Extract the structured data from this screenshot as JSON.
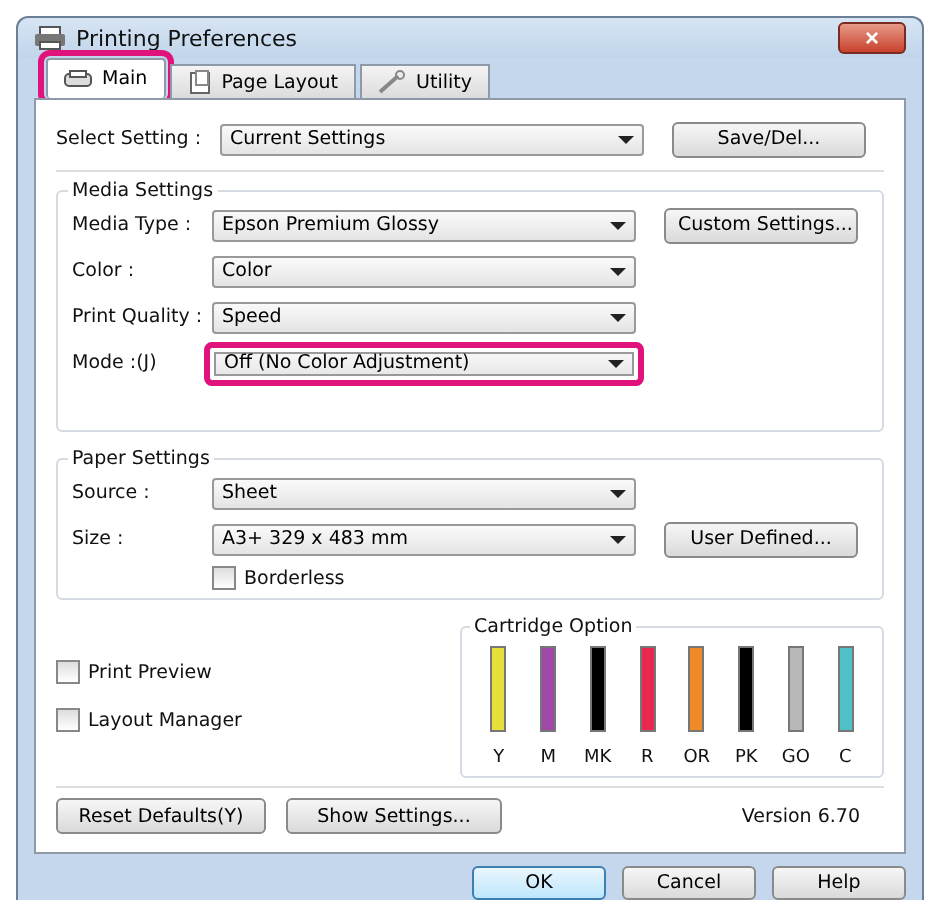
{
  "window": {
    "title": "Printing Preferences",
    "close": "×"
  },
  "tabs": [
    {
      "label": "Main",
      "selected": true,
      "highlighted": true
    },
    {
      "label": "Page Layout",
      "selected": false,
      "highlighted": false
    },
    {
      "label": "Utility",
      "selected": false,
      "highlighted": false
    }
  ],
  "select_setting": {
    "label": "Select Setting :",
    "value": "Current Settings",
    "button": "Save/Del..."
  },
  "media_settings": {
    "title": "Media Settings",
    "rows": [
      {
        "label": "Media Type :",
        "value": "Epson Premium Glossy",
        "highlighted": false,
        "button": "Custom Settings..."
      },
      {
        "label": "Color :",
        "value": "Color",
        "highlighted": false
      },
      {
        "label": "Print Quality :",
        "value": "Speed",
        "highlighted": false
      },
      {
        "label": "Mode :(J)",
        "value": "Off (No Color Adjustment)",
        "highlighted": true
      }
    ]
  },
  "paper_settings": {
    "title": "Paper Settings",
    "rows": [
      {
        "label": "Source :",
        "value": "Sheet"
      },
      {
        "label": "Size :",
        "value": "A3+ 329 x 483 mm",
        "button": "User Defined..."
      }
    ],
    "borderless": {
      "label": "Borderless",
      "checked": false
    }
  },
  "options": [
    {
      "label": "Print Preview",
      "checked": false
    },
    {
      "label": "Layout Manager",
      "checked": false
    }
  ],
  "cartridge_option": {
    "title": "Cartridge Option",
    "cartridges": [
      {
        "label": "Y",
        "color": "#e8e03a"
      },
      {
        "label": "M",
        "color": "#a04aa8"
      },
      {
        "label": "MK",
        "color": "#000000"
      },
      {
        "label": "R",
        "color": "#e82850"
      },
      {
        "label": "OR",
        "color": "#f08a28"
      },
      {
        "label": "PK",
        "color": "#000000"
      },
      {
        "label": "GO",
        "color": "#b8b8b8"
      },
      {
        "label": "C",
        "color": "#50c0c8"
      }
    ]
  },
  "bottom_buttons": [
    "Reset Defaults(Y)",
    "Show Settings..."
  ],
  "version": "Version 6.70",
  "dialog_buttons": [
    {
      "label": "OK",
      "default": true
    },
    {
      "label": "Cancel",
      "default": false
    },
    {
      "label": "Help",
      "default": false
    }
  ]
}
